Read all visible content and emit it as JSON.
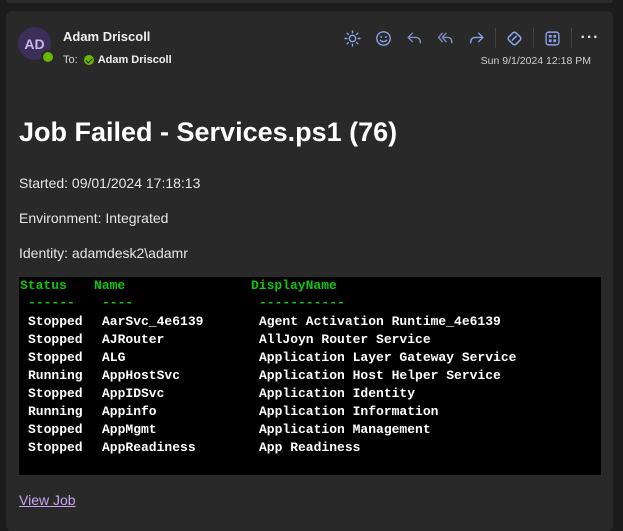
{
  "email": {
    "sender_initials": "AD",
    "sender_name": "Adam Driscoll",
    "to_label": "To:",
    "to_name": "Adam Driscoll",
    "date": "Sun 9/1/2024 12:18 PM"
  },
  "toolbar": {
    "icons": [
      "sun-icon",
      "smiley-icon",
      "reply-icon",
      "reply-all-icon",
      "forward-icon",
      "loop-icon",
      "apps-icon",
      "more-icon"
    ],
    "more_label": "···"
  },
  "body": {
    "title": "Job Failed - Services.ps1 (76)",
    "started": "Started: 09/01/2024 17:18:13",
    "environment": "Environment: Integrated",
    "identity": "Identity: adamdesk2\\adamr",
    "link": "View Job"
  },
  "console": {
    "headers": [
      "Status",
      "Name",
      "DisplayName"
    ],
    "dashes": [
      "------",
      "----",
      "-----------"
    ],
    "rows": [
      [
        "Stopped",
        "AarSvc_4e6139",
        "Agent Activation Runtime_4e6139"
      ],
      [
        "Stopped",
        "AJRouter",
        "AllJoyn Router Service"
      ],
      [
        "Stopped",
        "ALG",
        "Application Layer Gateway Service"
      ],
      [
        "Running",
        "AppHostSvc",
        "Application Host Helper Service"
      ],
      [
        "Stopped",
        "AppIDSvc",
        "Application Identity"
      ],
      [
        "Running",
        "Appinfo",
        "Application Information"
      ],
      [
        "Stopped",
        "AppMgmt",
        "Application Management"
      ],
      [
        "Stopped",
        "AppReadiness",
        "App Readiness"
      ]
    ]
  },
  "colors": {
    "background": "#1c1c1c",
    "card": "#292929",
    "console_bg": "#000000",
    "console_header": "#13c313",
    "link": "#c7a3f0",
    "accent_icon": "#8aa3e8",
    "presence": "#6bb700"
  }
}
